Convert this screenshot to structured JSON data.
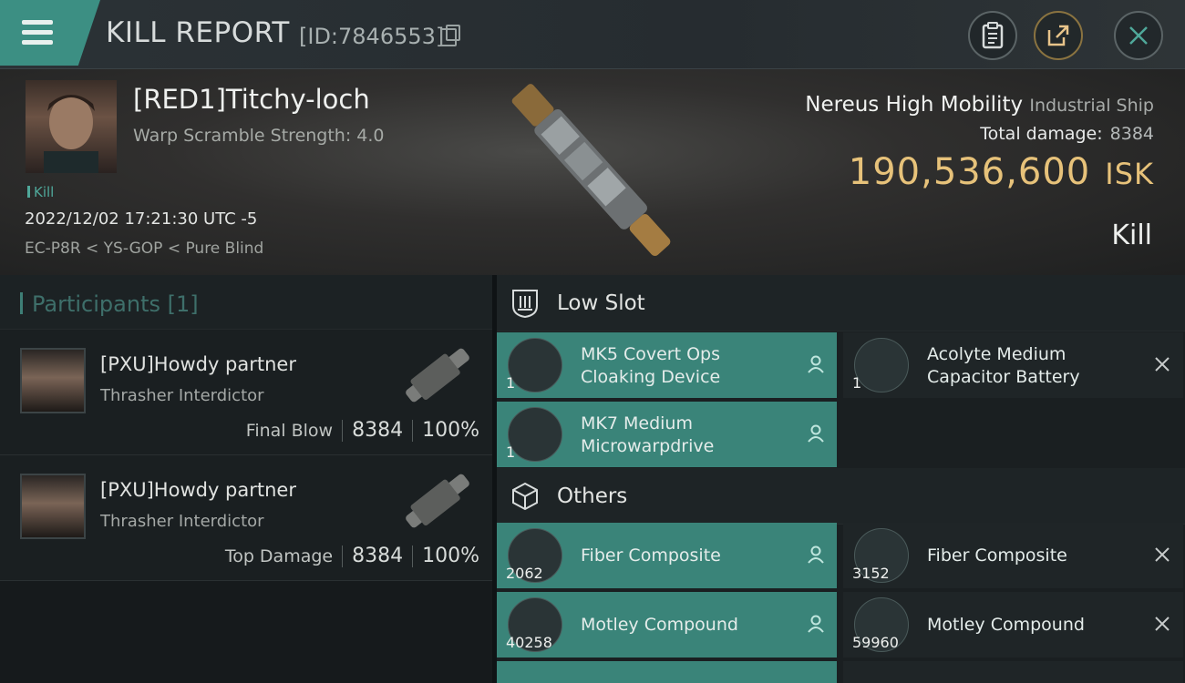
{
  "header": {
    "title": "KILL REPORT",
    "id_label": "[ID:7846553]",
    "icons": [
      "menu-icon",
      "copy-icon",
      "clipboard-icon",
      "share-icon",
      "close-icon"
    ]
  },
  "victim": {
    "name": "[RED1]Titchy-loch",
    "warp_scramble": "Warp Scramble Strength: 4.0",
    "tag": "Kill",
    "datetime": "2022/12/02 17:21:30 UTC -5",
    "location": "EC-P8R < YS-GOP < Pure Blind"
  },
  "ship": {
    "name": "Nereus High Mobility",
    "class": "Industrial Ship",
    "total_damage_label": "Total damage:",
    "total_damage": "8384",
    "isk_value": "190,536,600",
    "isk_unit": "ISK",
    "result": "Kill"
  },
  "participants": {
    "title": "Participants",
    "count": "[1]",
    "rows": [
      {
        "name": "[PXU]Howdy partner",
        "ship": "Thrasher Interdictor",
        "role": "Final Blow",
        "damage": "8384",
        "percent": "100%"
      },
      {
        "name": "[PXU]Howdy partner",
        "ship": "Thrasher Interdictor",
        "role": "Top Damage",
        "damage": "8384",
        "percent": "100%"
      }
    ]
  },
  "low_slot": {
    "title": "Low Slot",
    "items": [
      {
        "qty": "1",
        "name": "MK5 Covert Ops Cloaking Device",
        "state": "dropped"
      },
      {
        "qty": "1",
        "name": "Acolyte Medium Capacitor Battery",
        "state": "destroyed"
      },
      {
        "qty": "1",
        "name": "MK7 Medium Microwarpdrive",
        "state": "dropped"
      }
    ]
  },
  "others": {
    "title": "Others",
    "items": [
      {
        "qty": "2062",
        "name": "Fiber Composite",
        "state": "dropped"
      },
      {
        "qty": "3152",
        "name": "Fiber Composite",
        "state": "destroyed"
      },
      {
        "qty": "40258",
        "name": "Motley Compound",
        "state": "dropped"
      },
      {
        "qty": "59960",
        "name": "Motley Compound",
        "state": "destroyed"
      }
    ]
  },
  "colors": {
    "accent_teal": "#3a8479",
    "isk_gold": "#e7c27a"
  }
}
